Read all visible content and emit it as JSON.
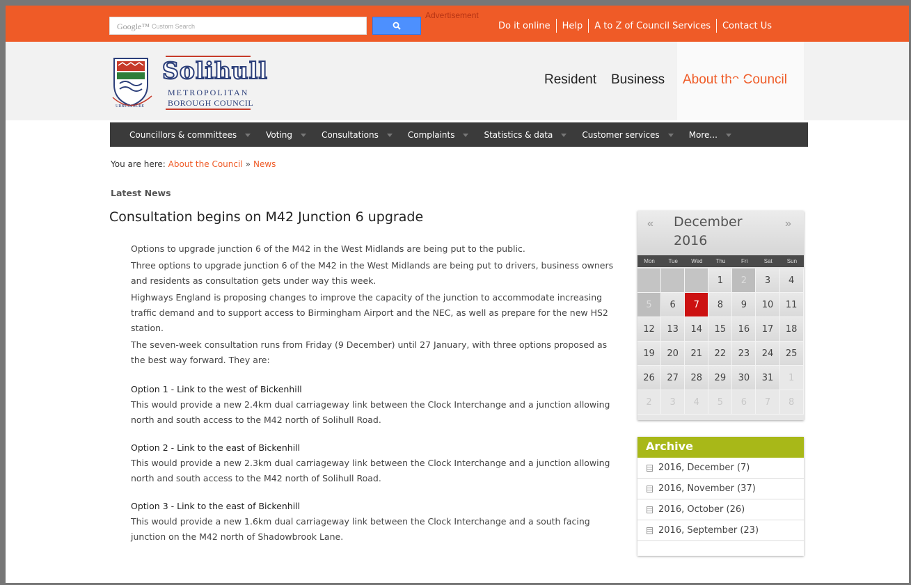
{
  "search": {
    "logo_text": "Google™",
    "placeholder_text": "Custom Search",
    "advertisement": "Advertisement"
  },
  "top_links": [
    "Do it online",
    "Help",
    "A to Z of Council Services",
    "Contact Us"
  ],
  "logo": {
    "title": "Solihull",
    "line1": "METROPOLITAN",
    "line2": "BOROUGH COUNCIL",
    "motto": "URBS IN RURE"
  },
  "main_nav": {
    "resident": "Resident",
    "business": "Business",
    "about": "About the Council"
  },
  "sub_nav": [
    "Councillors & committees",
    "Voting",
    "Consultations",
    "Complaints",
    "Statistics & data",
    "Customer services",
    "More..."
  ],
  "breadcrumb": {
    "prefix": "You are here:",
    "items": [
      "About the Council",
      "News"
    ],
    "separator": "»"
  },
  "section_title": "Latest News",
  "article": {
    "title": "Consultation begins on M42 Junction 6 upgrade",
    "paragraphs": [
      "Options to upgrade junction 6 of the M42 in the West Midlands are being put to the public.",
      "Three options to upgrade junction 6 of the M42 in the West Midlands are being put to drivers, business owners and residents as consultation gets under way this week.",
      "Highways England is proposing changes to improve the capacity of the junction to accommodate increasing traffic demand and to support access to Birmingham Airport and the NEC, as well as prepare for the new HS2 station.",
      "The seven-week consultation runs from Friday (9 December) until 27 January, with three options proposed as the best way forward. They are:"
    ],
    "options": [
      {
        "heading": "Option 1 - Link to the west of Bickenhill",
        "text": "This would provide a new 2.4km dual carriageway link between the Clock Interchange and a junction allowing north and south access to the M42 north of Solihull Road."
      },
      {
        "heading": "Option 2 - Link to the east of Bickenhill",
        "text": "This would provide a new 2.3km dual carriageway link between the Clock Interchange and a junction allowing north and south access to the M42 north of Solihull Road."
      },
      {
        "heading": "Option 3 - Link to the east of Bickenhill",
        "text": "This would provide a new 1.6km dual carriageway link between the Clock Interchange and a south facing junction on the M42 north of Shadowbrook Lane."
      }
    ]
  },
  "calendar": {
    "prev": "«",
    "next": "»",
    "month": "December",
    "year": "2016",
    "weekdays": [
      "Mon",
      "Tue",
      "Wed",
      "Thu",
      "Fri",
      "Sat",
      "Sun"
    ],
    "cells": [
      {
        "d": "",
        "t": "blank"
      },
      {
        "d": "",
        "t": "blank"
      },
      {
        "d": "",
        "t": "blank"
      },
      {
        "d": "1",
        "t": "n"
      },
      {
        "d": "2",
        "t": "dark"
      },
      {
        "d": "3",
        "t": "n"
      },
      {
        "d": "4",
        "t": "n"
      },
      {
        "d": "5",
        "t": "dark"
      },
      {
        "d": "6",
        "t": "n"
      },
      {
        "d": "7",
        "t": "today"
      },
      {
        "d": "8",
        "t": "n"
      },
      {
        "d": "9",
        "t": "n"
      },
      {
        "d": "10",
        "t": "n"
      },
      {
        "d": "11",
        "t": "n"
      },
      {
        "d": "12",
        "t": "n"
      },
      {
        "d": "13",
        "t": "n"
      },
      {
        "d": "14",
        "t": "n"
      },
      {
        "d": "15",
        "t": "n"
      },
      {
        "d": "16",
        "t": "n"
      },
      {
        "d": "17",
        "t": "n"
      },
      {
        "d": "18",
        "t": "n"
      },
      {
        "d": "19",
        "t": "n"
      },
      {
        "d": "20",
        "t": "n"
      },
      {
        "d": "21",
        "t": "n"
      },
      {
        "d": "22",
        "t": "n"
      },
      {
        "d": "23",
        "t": "n"
      },
      {
        "d": "24",
        "t": "n"
      },
      {
        "d": "25",
        "t": "n"
      },
      {
        "d": "26",
        "t": "n"
      },
      {
        "d": "27",
        "t": "n"
      },
      {
        "d": "28",
        "t": "n"
      },
      {
        "d": "29",
        "t": "n"
      },
      {
        "d": "30",
        "t": "n"
      },
      {
        "d": "31",
        "t": "n"
      },
      {
        "d": "1",
        "t": "dim"
      },
      {
        "d": "2",
        "t": "dim"
      },
      {
        "d": "3",
        "t": "dim"
      },
      {
        "d": "4",
        "t": "dim"
      },
      {
        "d": "5",
        "t": "dim"
      },
      {
        "d": "6",
        "t": "dim"
      },
      {
        "d": "7",
        "t": "dim"
      },
      {
        "d": "8",
        "t": "dim"
      }
    ]
  },
  "archive": {
    "title": "Archive",
    "items": [
      "2016, December (7)",
      "2016, November (37)",
      "2016, October (26)",
      "2016, September (23)"
    ]
  },
  "colors": {
    "brand_orange": "#ef5b27",
    "archive_green": "#a8b818",
    "today_red": "#cc1111",
    "subnav_bg": "#3b3b3b"
  },
  "icons": [
    "search-icon",
    "document-icon",
    "council-crest-logo"
  ]
}
